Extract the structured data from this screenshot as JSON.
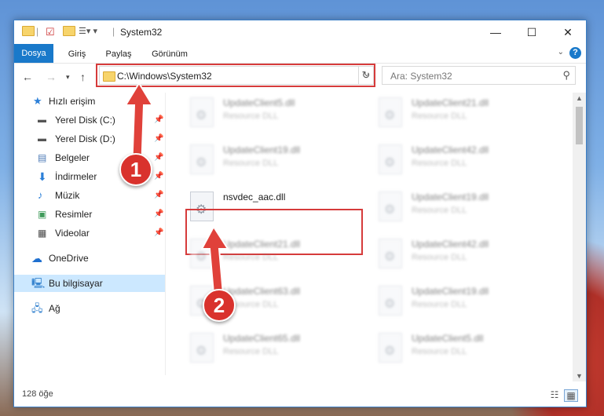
{
  "window": {
    "title": "System32"
  },
  "ribbon": {
    "tabs": [
      "Dosya",
      "Giriş",
      "Paylaş",
      "Görünüm"
    ],
    "help": "?"
  },
  "address": {
    "path": "C:\\Windows\\System32",
    "search_placeholder": "Ara: System32"
  },
  "sidebar": {
    "items": [
      {
        "label": "Hızlı erişim"
      },
      {
        "label": "Yerel Disk (C:)"
      },
      {
        "label": "Yerel Disk (D:)"
      },
      {
        "label": "Belgeler"
      },
      {
        "label": "İndirmeler"
      },
      {
        "label": "Müzik"
      },
      {
        "label": "Resimler"
      },
      {
        "label": "Videolar"
      },
      {
        "label": "OneDrive"
      },
      {
        "label": "Bu bilgisayar"
      },
      {
        "label": "Ağ"
      }
    ]
  },
  "files": {
    "left": [
      {
        "name": "UpdateClient5.dll",
        "type": "Resource DLL"
      },
      {
        "name": "UpdateClient19.dll",
        "type": "Resource DLL"
      },
      {
        "name": "nsvdec_aac.dll",
        "type": ""
      },
      {
        "name": "UpdateClient21.dll",
        "type": "Resource DLL"
      },
      {
        "name": "UpdateClient63.dll",
        "type": "Resource DLL"
      },
      {
        "name": "UpdateClient65.dll",
        "type": "Resource DLL"
      }
    ],
    "right": [
      {
        "name": "UpdateClient21.dll",
        "type": "Resource DLL"
      },
      {
        "name": "UpdateClient42.dll",
        "type": "Resource DLL"
      },
      {
        "name": "UpdateClient19.dll",
        "type": "Resource DLL"
      },
      {
        "name": "UpdateClient42.dll",
        "type": "Resource DLL"
      },
      {
        "name": "UpdateClient19.dll",
        "type": "Resource DLL"
      },
      {
        "name": "UpdateClient5.dll",
        "type": "Resource DLL"
      }
    ]
  },
  "status": {
    "count": "128 öğe"
  },
  "annotations": {
    "step1": "1",
    "step2": "2"
  },
  "colors": {
    "accent": "#1979ca",
    "highlight": "#d63b3b",
    "selection": "#cce8ff"
  },
  "icons": [
    "back-arrow-icon",
    "forward-arrow-icon",
    "up-arrow-icon",
    "folder-icon",
    "refresh-icon",
    "search-icon",
    "pin-icon",
    "star-icon",
    "drive-icon",
    "document-icon",
    "download-icon",
    "music-icon",
    "picture-icon",
    "video-icon",
    "cloud-icon",
    "computer-icon",
    "network-icon",
    "dll-file-icon"
  ]
}
